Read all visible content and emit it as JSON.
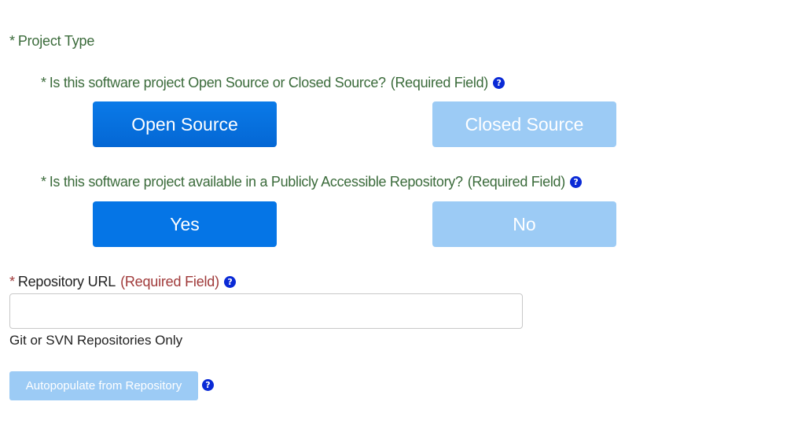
{
  "section": {
    "star": "*",
    "label": "Project Type"
  },
  "question_open_source": {
    "star": "*",
    "text": "Is this software project Open Source or Closed Source?",
    "required": "(Required Field)",
    "help_icon": "question-circle-icon",
    "options": [
      {
        "label": "Open Source",
        "selected": true
      },
      {
        "label": "Closed Source",
        "selected": false
      }
    ]
  },
  "question_public_repo": {
    "star": "*",
    "text": "Is this software project available in a Publicly Accessible Repository?",
    "required": "(Required Field)",
    "help_icon": "question-circle-icon",
    "options": [
      {
        "label": "Yes",
        "selected": true
      },
      {
        "label": "No",
        "selected": false
      }
    ]
  },
  "repository_url": {
    "star": "*",
    "label": "Repository URL",
    "required": "(Required Field)",
    "value": "",
    "placeholder": "",
    "hint": "Git or SVN Repositories Only"
  },
  "autopopulate": {
    "label": "Autopopulate from Repository",
    "enabled": false
  },
  "help_glyph": "?",
  "colors": {
    "question_text": "#3b6b3b",
    "required_red": "#a03a3a",
    "active_button": "#0575e6",
    "inactive_button": "#9ccbf5",
    "help_icon": "#0a2ad6"
  }
}
